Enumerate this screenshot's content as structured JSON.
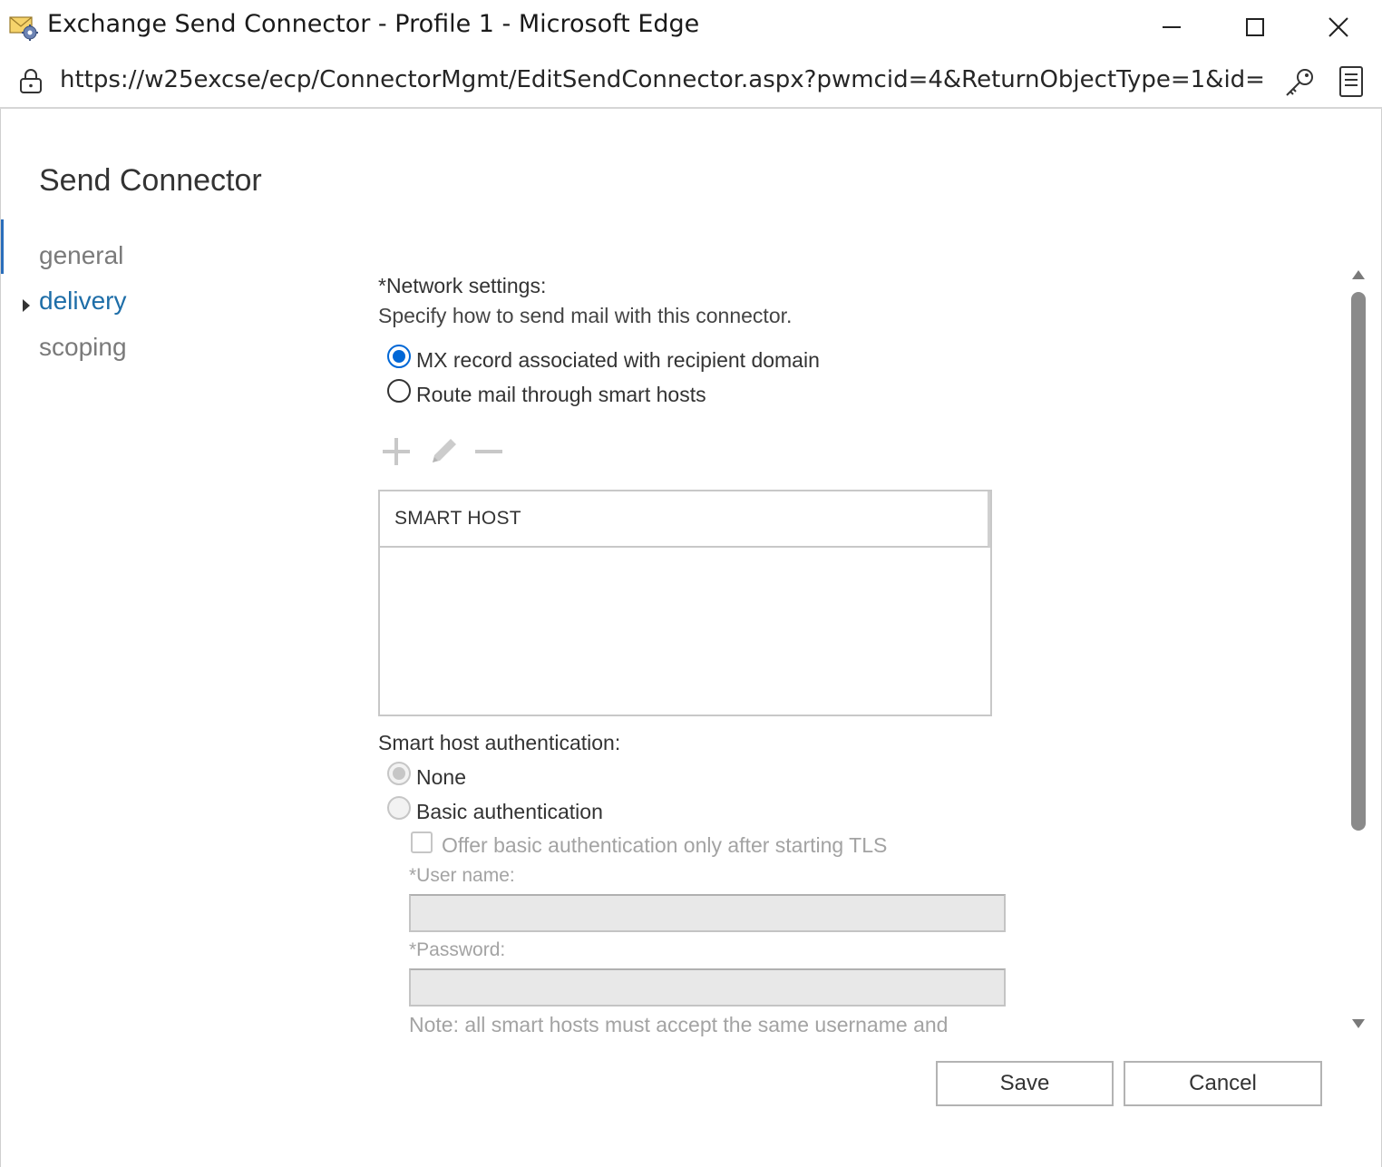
{
  "window": {
    "title": "Exchange Send Connector - Profile 1 - Microsoft Edge",
    "url": "https://w25excse/ecp/ConnectorMgmt/EditSendConnector.aspx?pwmcid=4&ReturnObjectType=1&id=5c..."
  },
  "page": {
    "title": "Send Connector"
  },
  "nav": {
    "items": [
      {
        "label": "general",
        "active": false
      },
      {
        "label": "delivery",
        "active": true
      },
      {
        "label": "scoping",
        "active": false
      }
    ]
  },
  "network": {
    "label": "*Network settings:",
    "description": "Specify how to send mail with this connector.",
    "option_mx": "MX record associated with recipient domain",
    "option_smart": "Route mail through smart hosts",
    "selected": "mx"
  },
  "smart_host_grid": {
    "column": "SMART HOST",
    "rows": []
  },
  "auth": {
    "label": "Smart host authentication:",
    "option_none": "None",
    "option_basic": "Basic authentication",
    "checkbox_tls": "Offer basic authentication only after starting TLS",
    "username_label": "*User name:",
    "username_value": "",
    "password_label": "*Password:",
    "password_value": "",
    "note": "Note: all smart hosts must accept the same username and"
  },
  "buttons": {
    "save": "Save",
    "cancel": "Cancel"
  },
  "icons": [
    "mail-gear-icon",
    "minimize-icon",
    "maximize-icon",
    "close-icon",
    "lock-icon",
    "key-icon",
    "reader-icon",
    "add-icon",
    "edit-icon",
    "remove-icon"
  ],
  "colors": {
    "accent": "#0067d6",
    "nav_active": "#1e6ea8",
    "disabled_text": "#a3a3a3"
  }
}
